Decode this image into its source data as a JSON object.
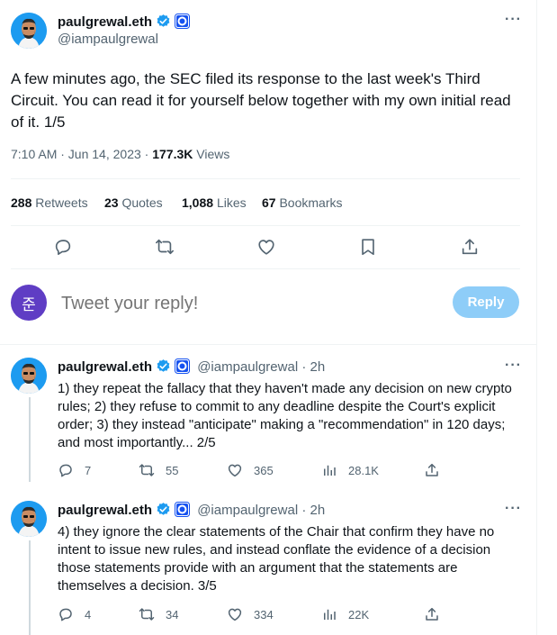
{
  "main_tweet": {
    "name": "paulgrewal.eth",
    "handle": "@iampaulgrewal",
    "text": "A few minutes ago, the SEC filed its response to the last week's Third Circuit. You can read it for yourself below together with my own initial read of it. 1/5",
    "time": "7:10 AM · Jun 14, 2023 ·",
    "views_count": "177.3K",
    "views_label": "Views",
    "stats": {
      "retweets_count": "288",
      "retweets_label": "Retweets",
      "quotes_count": "23",
      "quotes_label": "Quotes",
      "likes_count": "1,088",
      "likes_label": "Likes",
      "bookmarks_count": "67",
      "bookmarks_label": "Bookmarks"
    }
  },
  "composer": {
    "avatar_letter": "준",
    "avatar_color": "#5f3dc4",
    "placeholder": "Tweet your reply!",
    "button_label": "Reply"
  },
  "replies": [
    {
      "name": "paulgrewal.eth",
      "handle": "@iampaulgrewal",
      "time": "· 2h",
      "text": "1) they repeat the fallacy that they haven't made any decision on new crypto rules; 2) they refuse to commit to any deadline despite the Court's explicit order; 3) they instead \"anticipate\" making a \"recommendation\" in 120 days; and most importantly... 2/5",
      "replies": "7",
      "retweets": "55",
      "likes": "365",
      "views": "28.1K"
    },
    {
      "name": "paulgrewal.eth",
      "handle": "@iampaulgrewal",
      "time": "· 2h",
      "text": "4) they ignore the clear statements of the Chair that confirm they have no intent to issue new rules, and instead conflate the evidence of a decision those statements provide with an argument that the statements are themselves a decision. 3/5",
      "replies": "4",
      "retweets": "34",
      "likes": "334",
      "views": "22K"
    }
  ],
  "colors": {
    "accent": "#1d9bf0",
    "text": "#0f1419",
    "muted": "#536471",
    "reply_button": "#8ecdf8"
  }
}
